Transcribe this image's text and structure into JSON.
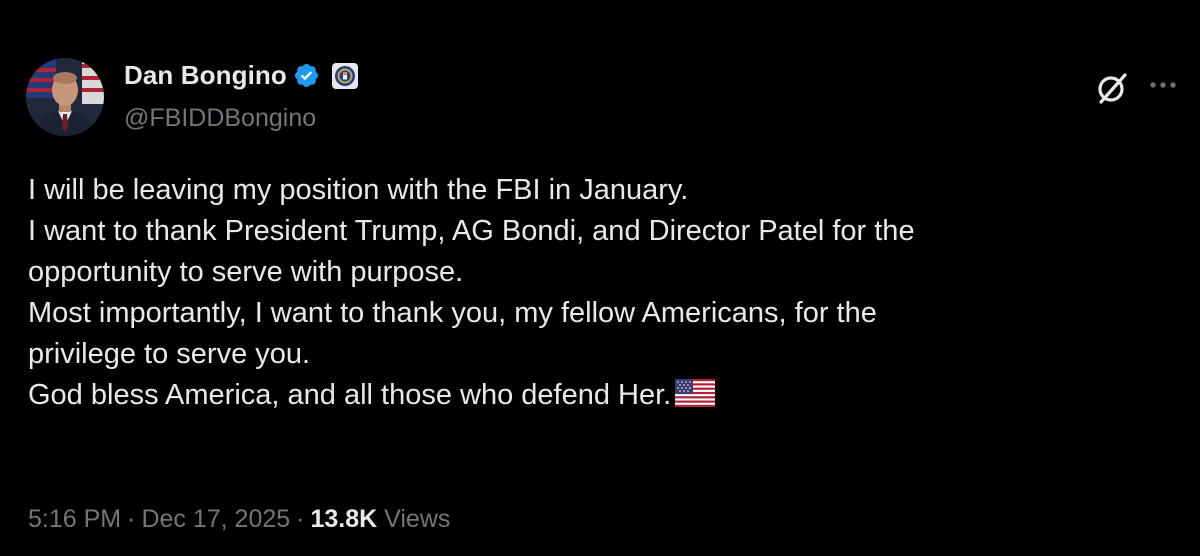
{
  "author": {
    "name": "Dan Bongino",
    "handle": "@FBIDDBongino"
  },
  "icons": {
    "verified": "verified-badge-icon",
    "affiliation": "fbi-seal-affiliation-icon",
    "grok": "grok-icon",
    "more": "more-options-icon",
    "flag": "us-flag-emoji-icon"
  },
  "tweet": {
    "lines": [
      "I will be leaving my position with the FBI in January.",
      "I want to thank President Trump, AG Bondi, and Director Patel for the",
      "opportunity to serve with purpose.",
      "Most importantly, I want to thank you, my fellow Americans, for the",
      "privilege to serve you.",
      "God bless America, and all those who defend Her."
    ]
  },
  "meta": {
    "time": "5:16 PM",
    "separator": "·",
    "date": "Dec 17, 2025",
    "views_count": "13.8K",
    "views_label": "Views"
  },
  "colors": {
    "background": "#000000",
    "text": "#e7e9ea",
    "secondary": "#71767b",
    "verified_blue": "#1d9bf0"
  }
}
